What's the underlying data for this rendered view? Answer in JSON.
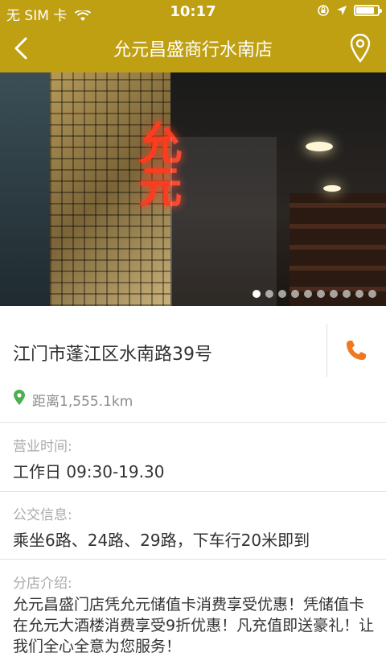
{
  "status_bar": {
    "carrier": "无 SIM 卡",
    "time": "10:17",
    "battery_level": 0.85
  },
  "nav": {
    "title": "允元昌盛商行水南店",
    "back_icon": "chevron-left-icon",
    "map_icon": "map-pin-icon"
  },
  "gallery": {
    "sign_text": "允元",
    "page_count": 10,
    "active_index": 0
  },
  "store": {
    "address": "江门市蓬江区水南路39号",
    "distance": "距离1,555.1km",
    "hours_label": "营业时间:",
    "hours_value": "工作日 09:30-19.30",
    "transit_label": "公交信息:",
    "transit_value": "乘坐6路、24路、29路，下车行20米即到",
    "intro_label": "分店介绍:",
    "intro_text": "允元昌盛门店凭允元储值卡消费享受优惠！凭储值卡在允元大酒楼消费享受9折优惠！凡充值即送豪礼！让我们全心全意为您服务！"
  },
  "colors": {
    "brand": "#c0a013",
    "phone": "#f07820",
    "pin": "#4caf50"
  }
}
